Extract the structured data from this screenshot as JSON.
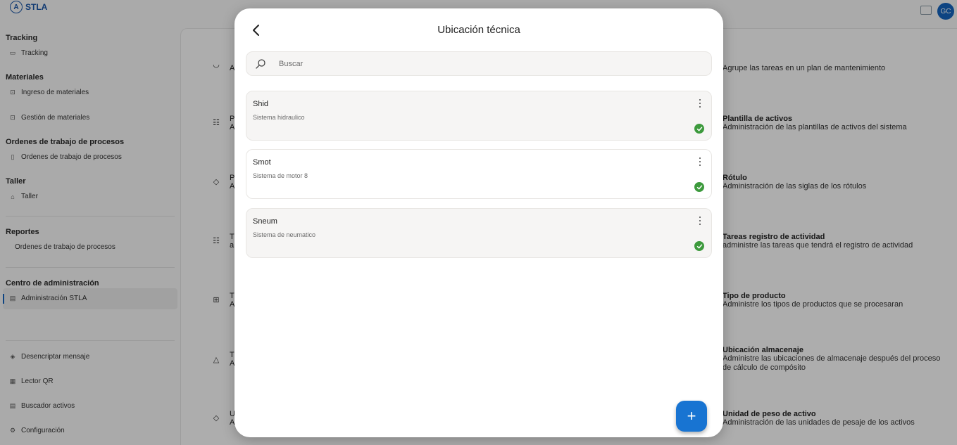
{
  "app": {
    "brand": "STLA",
    "avatar_initials": "GC"
  },
  "sidebar": {
    "sections": [
      {
        "title": "Tracking",
        "items": [
          {
            "label": "Tracking",
            "icon": "truck-icon"
          }
        ]
      },
      {
        "title": "Materiales",
        "items": [
          {
            "label": "Ingreso de materiales",
            "icon": "box-icon"
          },
          {
            "label": "Gestión de materiales",
            "icon": "box-icon"
          }
        ]
      },
      {
        "title": "Ordenes de trabajo de procesos",
        "items": [
          {
            "label": "Ordenes de trabajo de procesos",
            "icon": "doc-icon"
          }
        ]
      },
      {
        "title": "Taller",
        "items": [
          {
            "label": "Taller",
            "icon": "home-icon"
          }
        ]
      },
      {
        "title": "Reportes",
        "items": [
          {
            "label": "Ordenes de trabajo de procesos",
            "icon": ""
          }
        ]
      },
      {
        "title": "Centro de administración",
        "items": [
          {
            "label": "Administración STLA",
            "icon": "admin-icon"
          }
        ]
      }
    ],
    "bottom_items": [
      {
        "label": "Desencriptar mensaje",
        "icon": "shield-icon"
      },
      {
        "label": "Lector QR",
        "icon": "qr-icon"
      },
      {
        "label": "Buscador activos",
        "icon": "search-doc-icon"
      },
      {
        "label": "Configuración",
        "icon": "gear-icon"
      }
    ]
  },
  "background_rows": [
    {
      "letter": "A",
      "title": "",
      "desc": "Agrupe las tareas en un plan de mantenimiento"
    },
    {
      "letter": "P",
      "sub": "A",
      "title": "Plantilla de activos",
      "desc": "Administración de las plantillas de activos del sistema"
    },
    {
      "letter": "P",
      "sub": "A",
      "title": "Rótulo",
      "desc": "Administración de las siglas de los rótulos"
    },
    {
      "letter": "T",
      "sub": "a",
      "title": "Tareas registro de actividad",
      "desc": "administre las tareas que tendrá el registro de actividad"
    },
    {
      "letter": "T",
      "sub": "A",
      "title": "Tipo de producto",
      "desc": "Administre los tipos de productos que se procesaran"
    },
    {
      "letter": "T",
      "sub": "A",
      "title": "Ubicación almacenaje",
      "desc": "Administre las ubicaciones de almacenaje después del proceso de cálculo de compósito"
    },
    {
      "letter": "U",
      "sub": "A",
      "title": "Unidad de peso de activo",
      "desc": "Administración de las unidades de pesaje de los activos"
    }
  ],
  "modal": {
    "title": "Ubicación técnica",
    "search_placeholder": "Buscar",
    "items": [
      {
        "title": "Shid",
        "subtitle": "Sistema hidraulico",
        "status": "active"
      },
      {
        "title": "Smot",
        "subtitle": "Sistema de motor 8",
        "status": "active"
      },
      {
        "title": "Sneum",
        "subtitle": "Sistema de neumatico",
        "status": "active"
      }
    ],
    "add_button": "+"
  },
  "colors": {
    "accent": "#1874d2",
    "success": "#3d9a3d",
    "brand": "#1a56a8"
  }
}
